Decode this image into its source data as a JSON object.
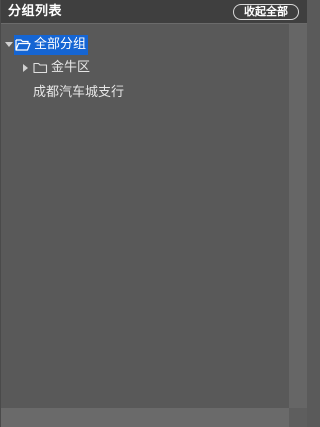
{
  "header": {
    "title": "分组列表",
    "collapse_all_label": "收起全部"
  },
  "tree": {
    "root": {
      "label": "全部分组",
      "expanded": true,
      "selected": true,
      "icon": "folder-open-icon"
    },
    "children": [
      {
        "label": "金牛区",
        "expanded": false,
        "icon": "folder-icon"
      },
      {
        "label": "成都汽车城支行",
        "icon": "none"
      }
    ]
  },
  "colors": {
    "panel_bg": "#595959",
    "header_bg": "#3f3f3f",
    "selection": "#1565d3",
    "text": "#e6e6e6"
  }
}
